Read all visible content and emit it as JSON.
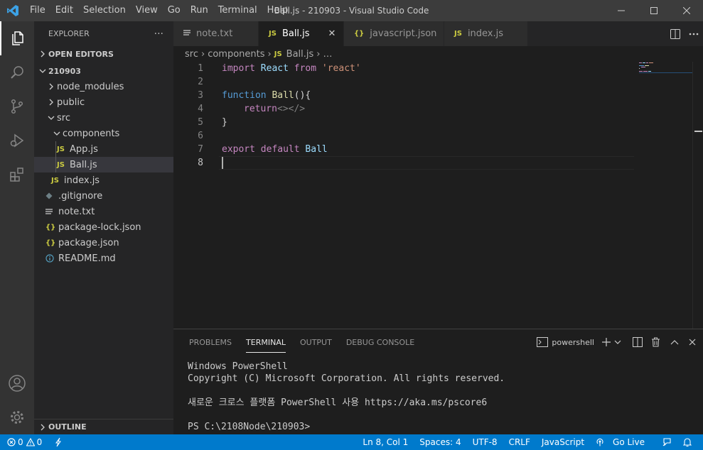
{
  "window": {
    "title": "Ball.js - 210903 - Visual Studio Code",
    "menu": [
      "File",
      "Edit",
      "Selection",
      "View",
      "Go",
      "Run",
      "Terminal",
      "Help"
    ]
  },
  "activity_bar": [
    "explorer-icon",
    "search-icon",
    "source-control-icon",
    "run-debug-icon",
    "extensions-icon",
    "accounts-icon",
    "manage-gear-icon"
  ],
  "sidebar": {
    "title": "EXPLORER",
    "more": "···",
    "open_editors": "OPEN EDITORS",
    "root": "210903",
    "tree": [
      {
        "label": "node_modules",
        "type": "folder"
      },
      {
        "label": "public",
        "type": "folder"
      },
      {
        "label": "src",
        "type": "folder-open"
      },
      {
        "label": "components",
        "type": "folder-open"
      },
      {
        "label": "App.js",
        "type": "js"
      },
      {
        "label": "Ball.js",
        "type": "js"
      },
      {
        "label": "index.js",
        "type": "js"
      },
      {
        "label": ".gitignore",
        "type": "git"
      },
      {
        "label": "note.txt",
        "type": "txt"
      },
      {
        "label": "package-lock.json",
        "type": "json"
      },
      {
        "label": "package.json",
        "type": "json"
      },
      {
        "label": "README.md",
        "type": "md"
      }
    ],
    "outline": "OUTLINE"
  },
  "icons": {
    "js": "JS",
    "json": "{}",
    "close": "✕"
  },
  "tabs": [
    {
      "label": "note.txt"
    },
    {
      "label": "Ball.js"
    },
    {
      "label": "javascript.json"
    },
    {
      "label": "index.js"
    }
  ],
  "breadcrumb": {
    "a": "src",
    "b": "components",
    "c": "Ball.js",
    "d": "…"
  },
  "editor": {
    "line_numbers": [
      "1",
      "2",
      "3",
      "4",
      "5",
      "6",
      "7",
      "8"
    ],
    "l1": {
      "kw": "import",
      "name": "React",
      "from": "from",
      "str": "'react'"
    },
    "l3": {
      "kw": "function",
      "name": "Ball",
      "rest": "(){"
    },
    "l4": {
      "kw": "return",
      "tag": "<></>"
    },
    "l5": "}",
    "l7": {
      "kw1": "export",
      "kw2": "default",
      "name": "Ball"
    }
  },
  "panel": {
    "tabs": [
      "PROBLEMS",
      "TERMINAL",
      "OUTPUT",
      "DEBUG CONSOLE"
    ],
    "shell": "powershell",
    "terminal_lines": [
      "Windows PowerShell",
      "Copyright (C) Microsoft Corporation. All rights reserved.",
      "",
      "새로운 크로스 플랫폼 PowerShell 사용 https://aka.ms/pscore6",
      "",
      "PS C:\\2108Node\\210903>"
    ]
  },
  "status": {
    "errors": "0",
    "warnings": "0",
    "position": "Ln 8, Col 1",
    "spaces": "Spaces: 4",
    "encoding": "UTF-8",
    "eol": "CRLF",
    "language": "JavaScript",
    "golive": "Go Live"
  }
}
